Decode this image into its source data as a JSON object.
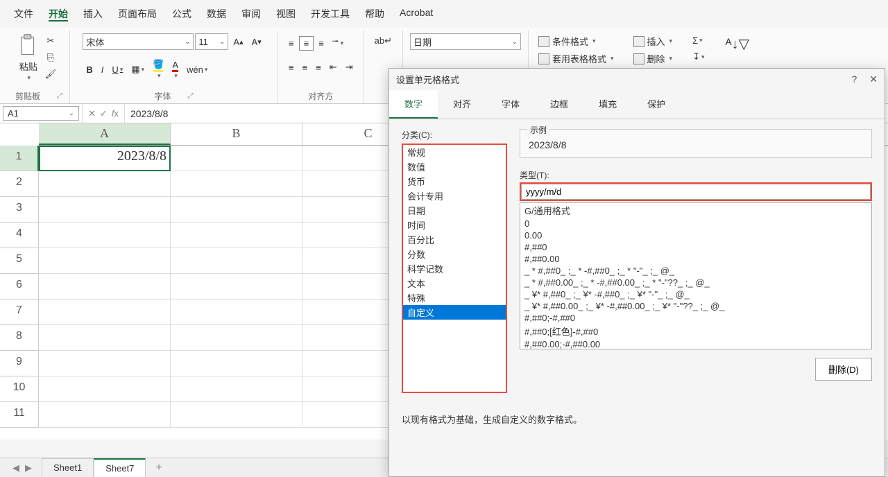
{
  "menu": {
    "items": [
      "文件",
      "开始",
      "插入",
      "页面布局",
      "公式",
      "数据",
      "审阅",
      "视图",
      "开发工具",
      "帮助",
      "Acrobat"
    ],
    "active": "开始"
  },
  "ribbon": {
    "clipboard": {
      "paste": "粘贴",
      "group_label": "剪贴板"
    },
    "font": {
      "name": "宋体",
      "size": "11",
      "bold": "B",
      "italic": "I",
      "underline": "U",
      "ruby": "wén",
      "group_label": "字体"
    },
    "alignment": {
      "group_label": "对齐方"
    },
    "number": {
      "format": "日期"
    },
    "styles": {
      "conditional": "条件格式",
      "table": "套用表格格式",
      "insert": "插入",
      "delete": "删除"
    }
  },
  "formula_bar": {
    "name_box": "A1",
    "value": "2023/8/8"
  },
  "grid": {
    "columns": [
      "A",
      "B",
      "C"
    ],
    "active_col": "A",
    "row_count": 11,
    "active_row": 1,
    "cells": {
      "A1": "2023/8/8"
    }
  },
  "sheets": {
    "tabs": [
      "Sheet1",
      "Sheet7"
    ],
    "active": "Sheet7"
  },
  "dialog": {
    "title": "设置单元格格式",
    "tabs": [
      "数字",
      "对齐",
      "字体",
      "边框",
      "填充",
      "保护"
    ],
    "active_tab": "数字",
    "category_label": "分类(C):",
    "categories": [
      "常规",
      "数值",
      "货币",
      "会计专用",
      "日期",
      "时间",
      "百分比",
      "分数",
      "科学记数",
      "文本",
      "特殊",
      "自定义"
    ],
    "selected_category": "自定义",
    "sample_label": "示例",
    "sample_value": "2023/8/8",
    "type_label": "类型(T):",
    "type_value": "yyyy/m/d",
    "formats": [
      "G/通用格式",
      "0",
      "0.00",
      "#,##0",
      "#,##0.00",
      "_ * #,##0_ ;_ * -#,##0_ ;_ * \"-\"_ ;_ @_ ",
      "_ * #,##0.00_ ;_ * -#,##0.00_ ;_ * \"-\"??_ ;_ @_ ",
      "_ ¥* #,##0_ ;_ ¥* -#,##0_ ;_ ¥* \"-\"_ ;_ @_ ",
      "_ ¥* #,##0.00_ ;_ ¥* -#,##0.00_ ;_ ¥* \"-\"??_ ;_ @_ ",
      "#,##0;-#,##0",
      "#,##0;[红色]-#,##0",
      "#,##0.00;-#,##0.00"
    ],
    "delete_btn": "删除(D)",
    "hint": "以现有格式为基础，生成自定义的数字格式。"
  }
}
